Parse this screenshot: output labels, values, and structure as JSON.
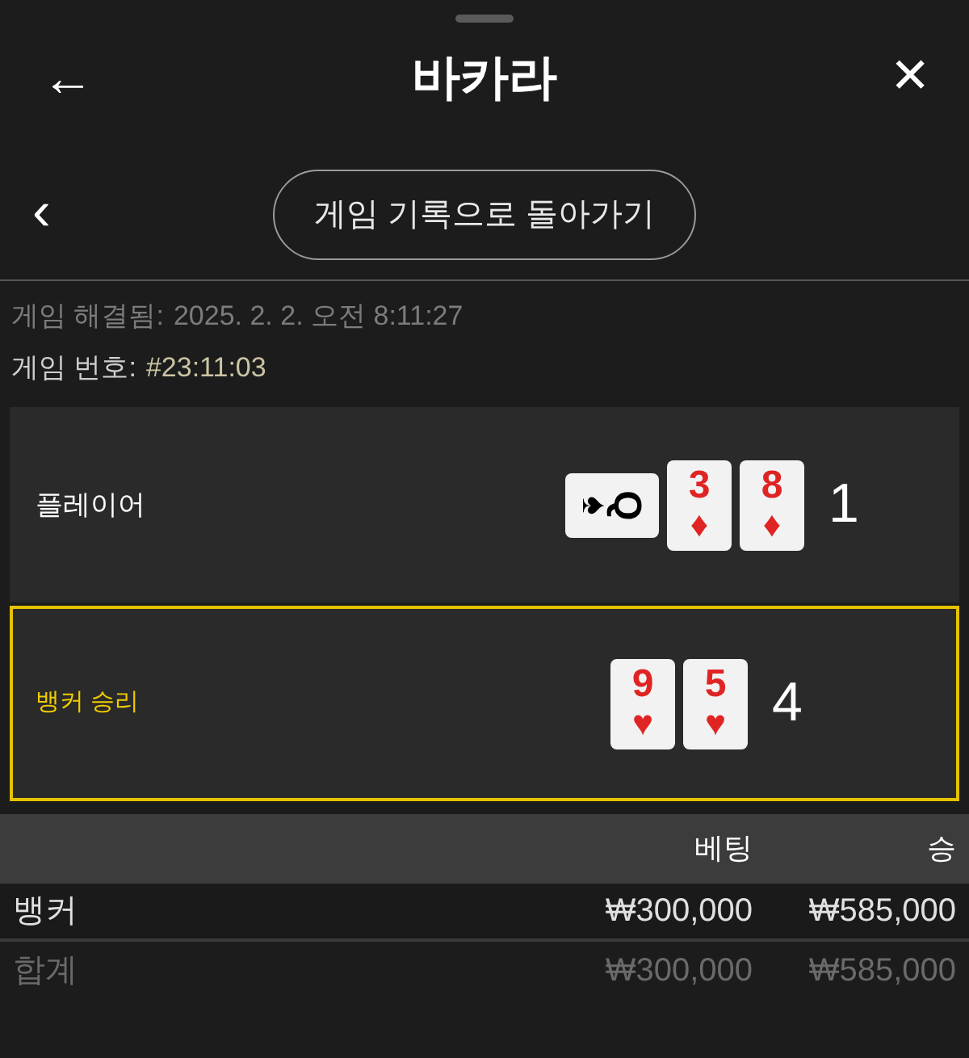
{
  "header": {
    "back_icon": "←",
    "title": "바카라",
    "close_icon": "✕"
  },
  "nav": {
    "chevron": "‹",
    "button": "게임 기록으로 돌아가기"
  },
  "info": [
    {
      "label": "게임 해결됨:",
      "value": "2025. 2. 2. 오전 8:11:27",
      "kind": "dim"
    },
    {
      "label": "게임 번호:",
      "value": "#23:11:03",
      "kind": "bright"
    }
  ],
  "hands": [
    {
      "label": "플레이어",
      "winner": false,
      "score": "1",
      "cards": [
        {
          "rank": "Q",
          "suit": "♠",
          "rotated": true
        },
        {
          "rank": "3",
          "suit": "♦",
          "rotated": false
        },
        {
          "rank": "8",
          "suit": "♦",
          "rotated": false
        }
      ]
    },
    {
      "label": "뱅커 승리",
      "winner": true,
      "score": "4",
      "cards": [
        {
          "rank": "9",
          "suit": "♥",
          "rotated": false
        },
        {
          "rank": "5",
          "suit": "♥",
          "rotated": false
        }
      ]
    }
  ],
  "table": {
    "columns": [
      "",
      "베팅",
      "승"
    ],
    "rows": [
      {
        "kind": "bet",
        "cells": [
          "뱅커",
          "₩300,000",
          "₩585,000"
        ]
      },
      {
        "kind": "total",
        "cells": [
          "합계",
          "₩300,000",
          "₩585,000"
        ]
      }
    ]
  }
}
